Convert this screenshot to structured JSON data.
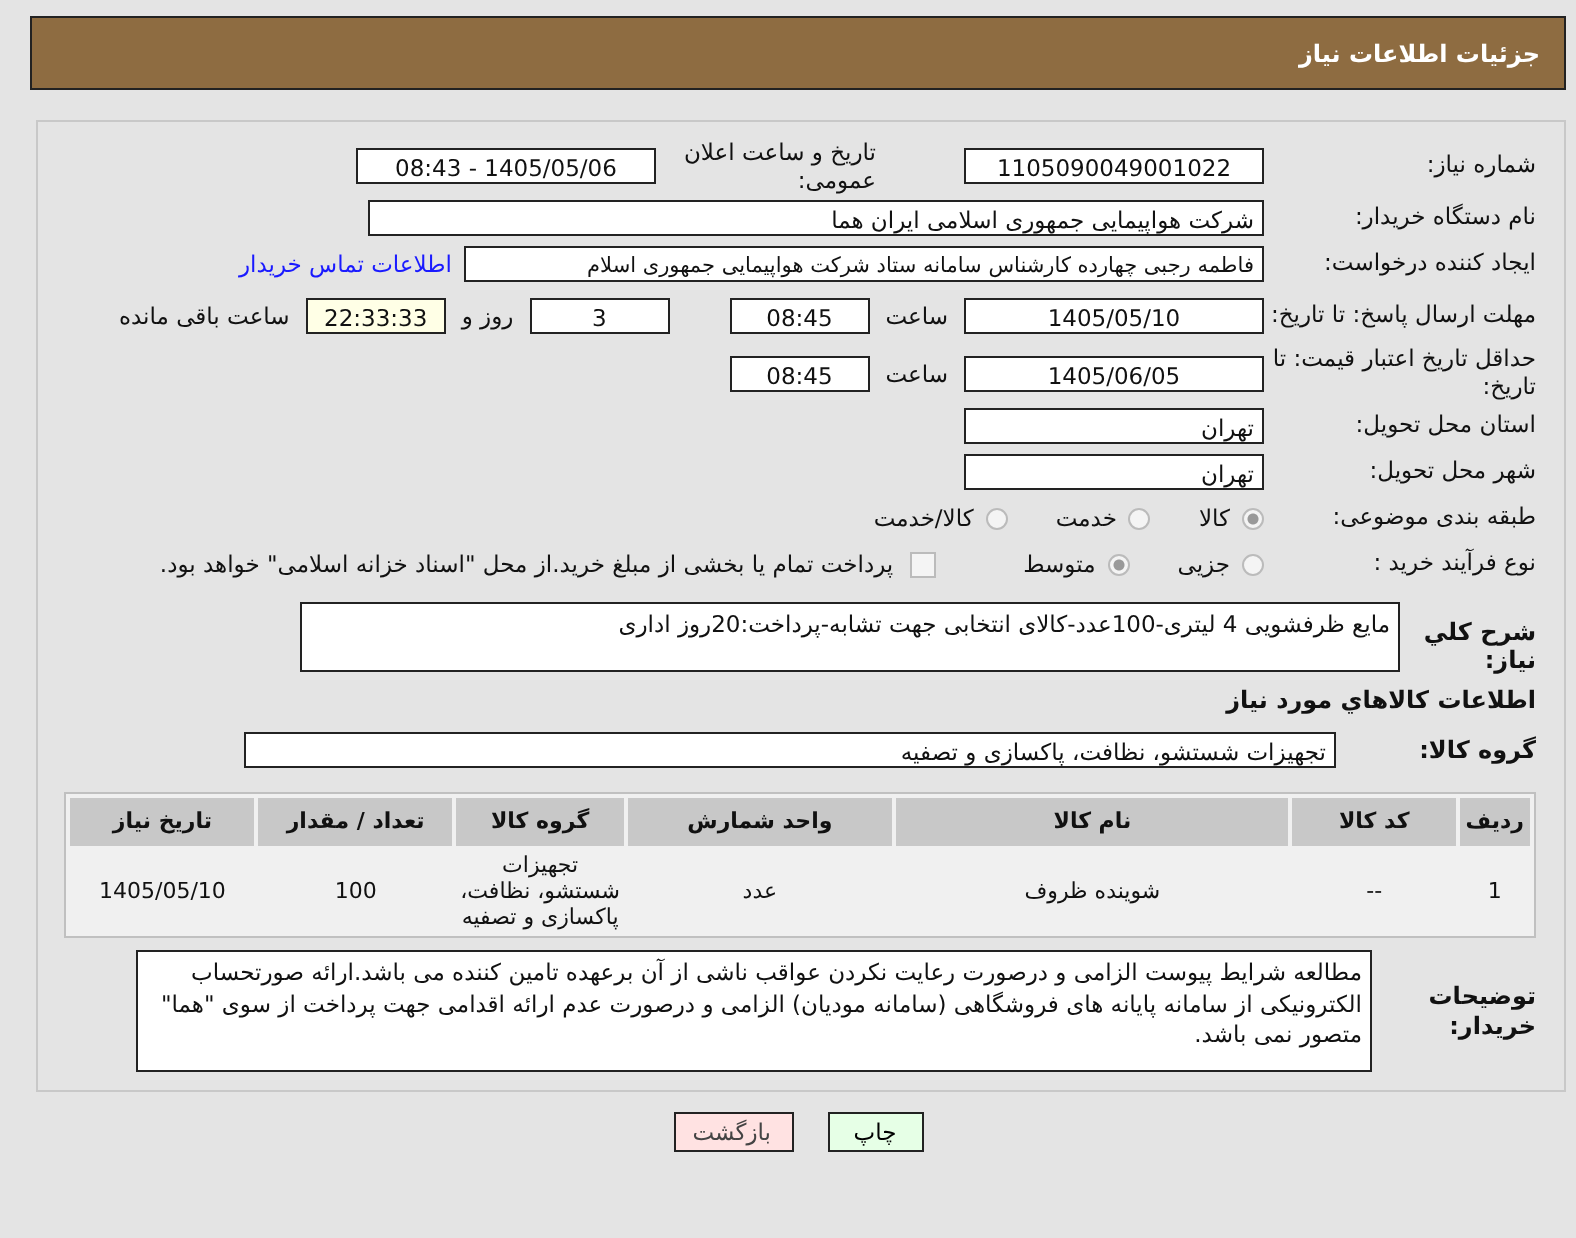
{
  "header": {
    "title": "جزئیات اطلاعات نیاز"
  },
  "need_number": {
    "label": "شماره نیاز:",
    "value": "1105090049001022"
  },
  "announce": {
    "label": "تاریخ و ساعت اعلان عمومی:",
    "value": "1405/05/06 - 08:43"
  },
  "buyer_org": {
    "label": "نام دستگاه خریدار:",
    "value": "شرکت هواپیمایی جمهوری اسلامی ایران هما"
  },
  "requester": {
    "label": "ایجاد کننده درخواست:",
    "value": "فاطمه رجبی چهارده کارشناس سامانه ستاد شرکت هواپیمایی جمهوری اسلام",
    "link": "اطلاعات تماس خریدار"
  },
  "deadline": {
    "label": "مهلت ارسال پاسخ: تا تاریخ:",
    "date": "1405/05/10",
    "time_label": "ساعت",
    "time": "08:45",
    "days": "3",
    "days_label": "روز و",
    "remaining": "22:33:33",
    "remaining_label": "ساعت باقی مانده"
  },
  "validity": {
    "label": "حداقل تاریخ اعتبار قیمت: تا تاریخ:",
    "date": "1405/06/05",
    "time_label": "ساعت",
    "time": "08:45"
  },
  "province": {
    "label": "استان محل تحویل:",
    "value": "تهران"
  },
  "city": {
    "label": "شهر محل تحویل:",
    "value": "تهران"
  },
  "category": {
    "label": "طبقه بندی موضوعی:",
    "options": [
      {
        "label": "کالا",
        "selected": true
      },
      {
        "label": "خدمت",
        "selected": false
      },
      {
        "label": "کالا/خدمت",
        "selected": false
      }
    ]
  },
  "process": {
    "label": "نوع فرآیند خرید :",
    "options": [
      {
        "label": "جزیی",
        "selected": false
      },
      {
        "label": "متوسط",
        "selected": true
      }
    ],
    "payment": {
      "label": "پرداخت تمام یا بخشی از مبلغ خرید.از محل \"اسناد خزانه اسلامی\" خواهد بود.",
      "checked": false
    }
  },
  "description": {
    "label": "شرح كلي نياز:",
    "value": "مایع ظرفشویی 4 لیتری-100عدد-کالای انتخابی جهت تشابه-پرداخت:20روز اداری"
  },
  "goods_heading": "اطلاعات كالاهاي مورد نياز",
  "group": {
    "label": "گروه کالا:",
    "value": "تجهیزات شستشو، نظافت، پاکسازی و تصفیه"
  },
  "table": {
    "columns": [
      "ردیف",
      "کد کالا",
      "نام کالا",
      "واحد شمارش",
      "گروه کالا",
      "تعداد / مقدار",
      "تاریخ نیاز"
    ],
    "rows": [
      [
        "1",
        "--",
        "شوینده ظروف",
        "عدد",
        "تجهیزات شستشو، نظافت، پاکسازی و تصفیه",
        "100",
        "1405/05/10"
      ]
    ]
  },
  "notes": {
    "label": "توضیحات خریدار:",
    "value": "مطالعه شرایط پیوست الزامی و درصورت رعایت نکردن عواقب ناشی از آن برعهده تامین کننده می باشد.ارائه صورتحساب الکترونیکی از سامانه پایانه های فروشگاهی (سامانه مودیان) الزامی و درصورت عدم ارائه اقدامی جهت پرداخت از سوی \"هما\" متصور نمی باشد."
  },
  "buttons": [
    {
      "label": "چاپ",
      "kind": "print"
    },
    {
      "label": "بازگشت",
      "kind": "back"
    }
  ]
}
